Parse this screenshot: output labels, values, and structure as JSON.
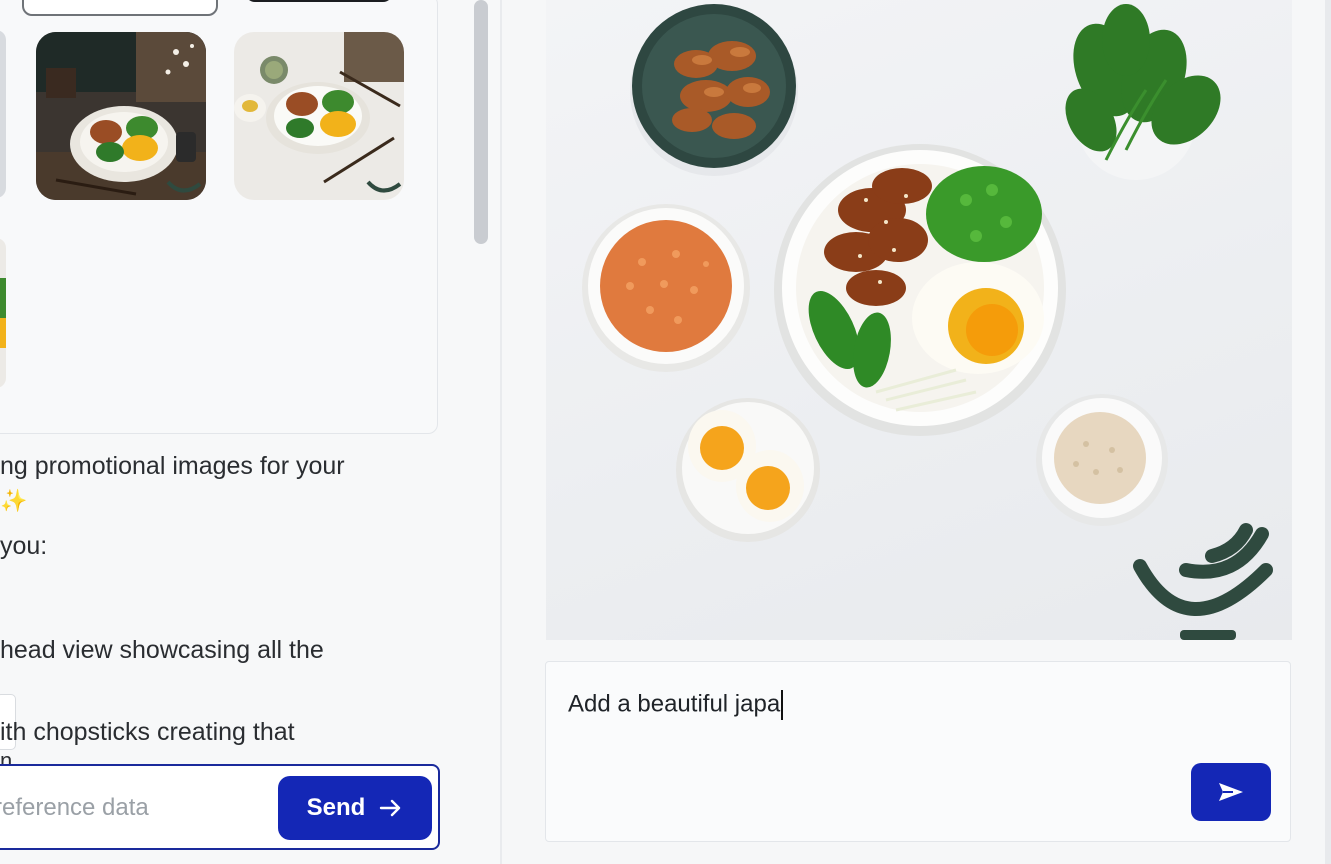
{
  "chat": {
    "lines": [
      "ng promotional images for your",
      " you:",
      "head view showcasing all the",
      "ith chopsticks creating that"
    ],
    "sparkle_glyph": "✨",
    "cut_glyph": "n"
  },
  "input": {
    "placeholder": "reference data",
    "send_label": "Send",
    "send_icon": "arrow-right-icon"
  },
  "prompt": {
    "text": "Add a beautiful japa",
    "send_icon": "paper-plane-icon"
  },
  "colors": {
    "accent": "#1427b6",
    "accent_border": "#1a2a9c",
    "logo_green": "#2f4a3f"
  }
}
